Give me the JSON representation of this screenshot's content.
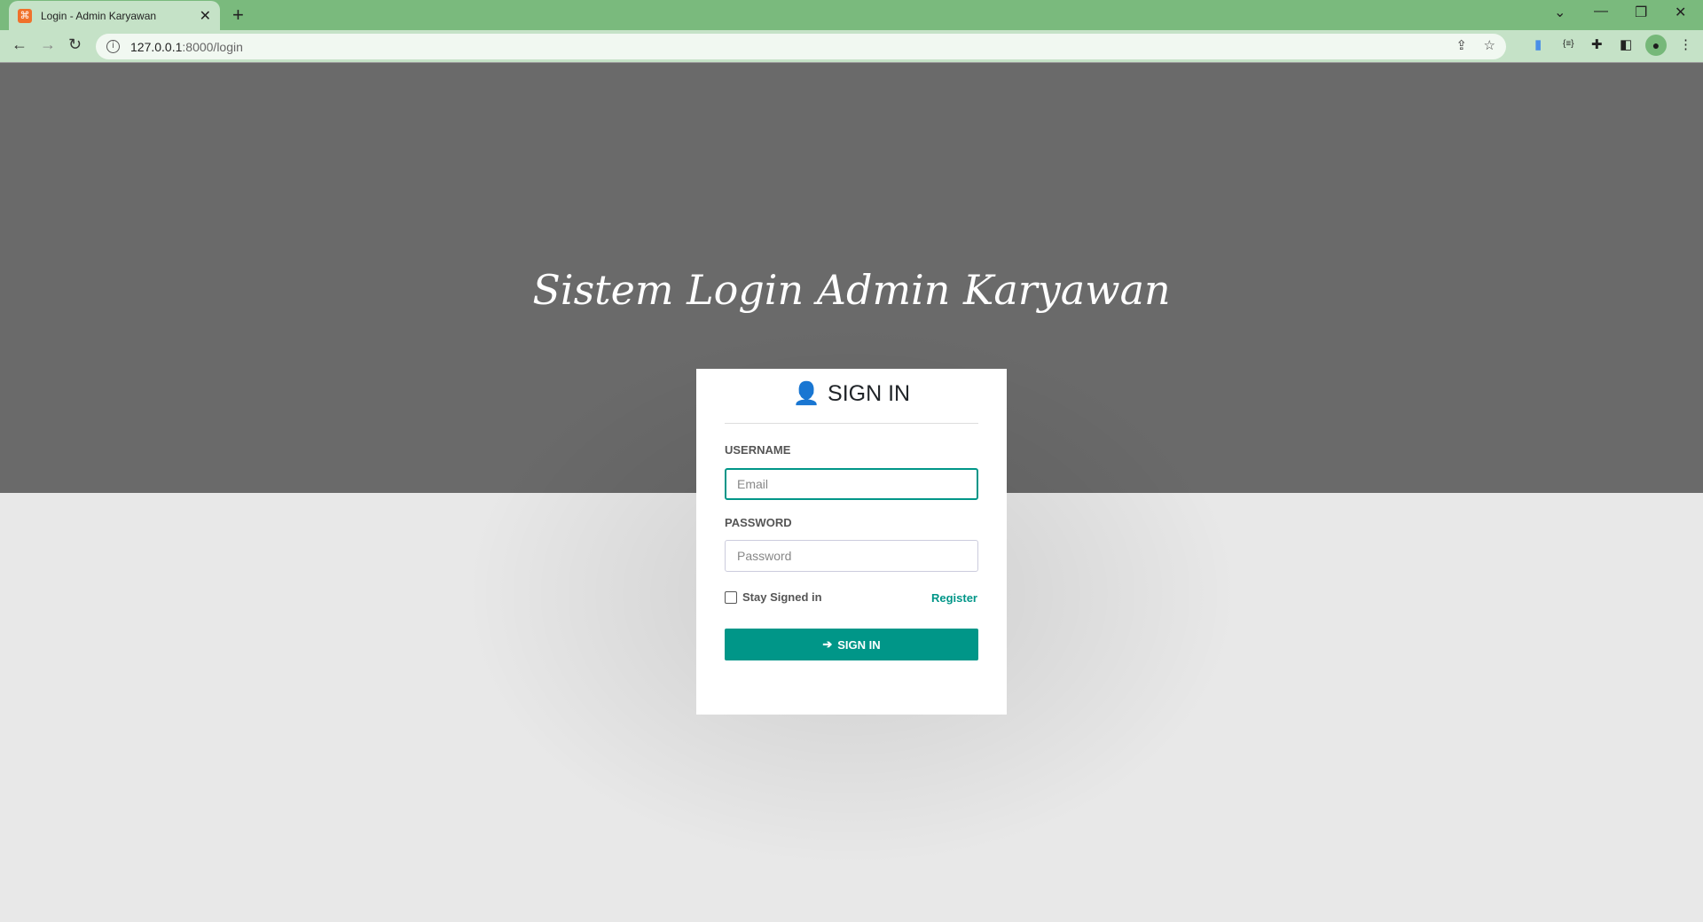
{
  "browser": {
    "tab_title": "Login - Admin Karyawan",
    "url_host": "127.0.0.1",
    "url_path": ":8000/login"
  },
  "page": {
    "heading": "Sistem Login Admin Karyawan"
  },
  "form": {
    "title": "SIGN IN",
    "username_label": "USERNAME",
    "username_placeholder": "Email",
    "password_label": "PASSWORD",
    "password_placeholder": "Password",
    "remember_label": "Stay Signed in",
    "register_link": "Register",
    "submit_label": "SIGN IN"
  },
  "colors": {
    "accent": "#009688",
    "browser_frame": "#7aba7d",
    "hero": "#6a6a6a"
  }
}
